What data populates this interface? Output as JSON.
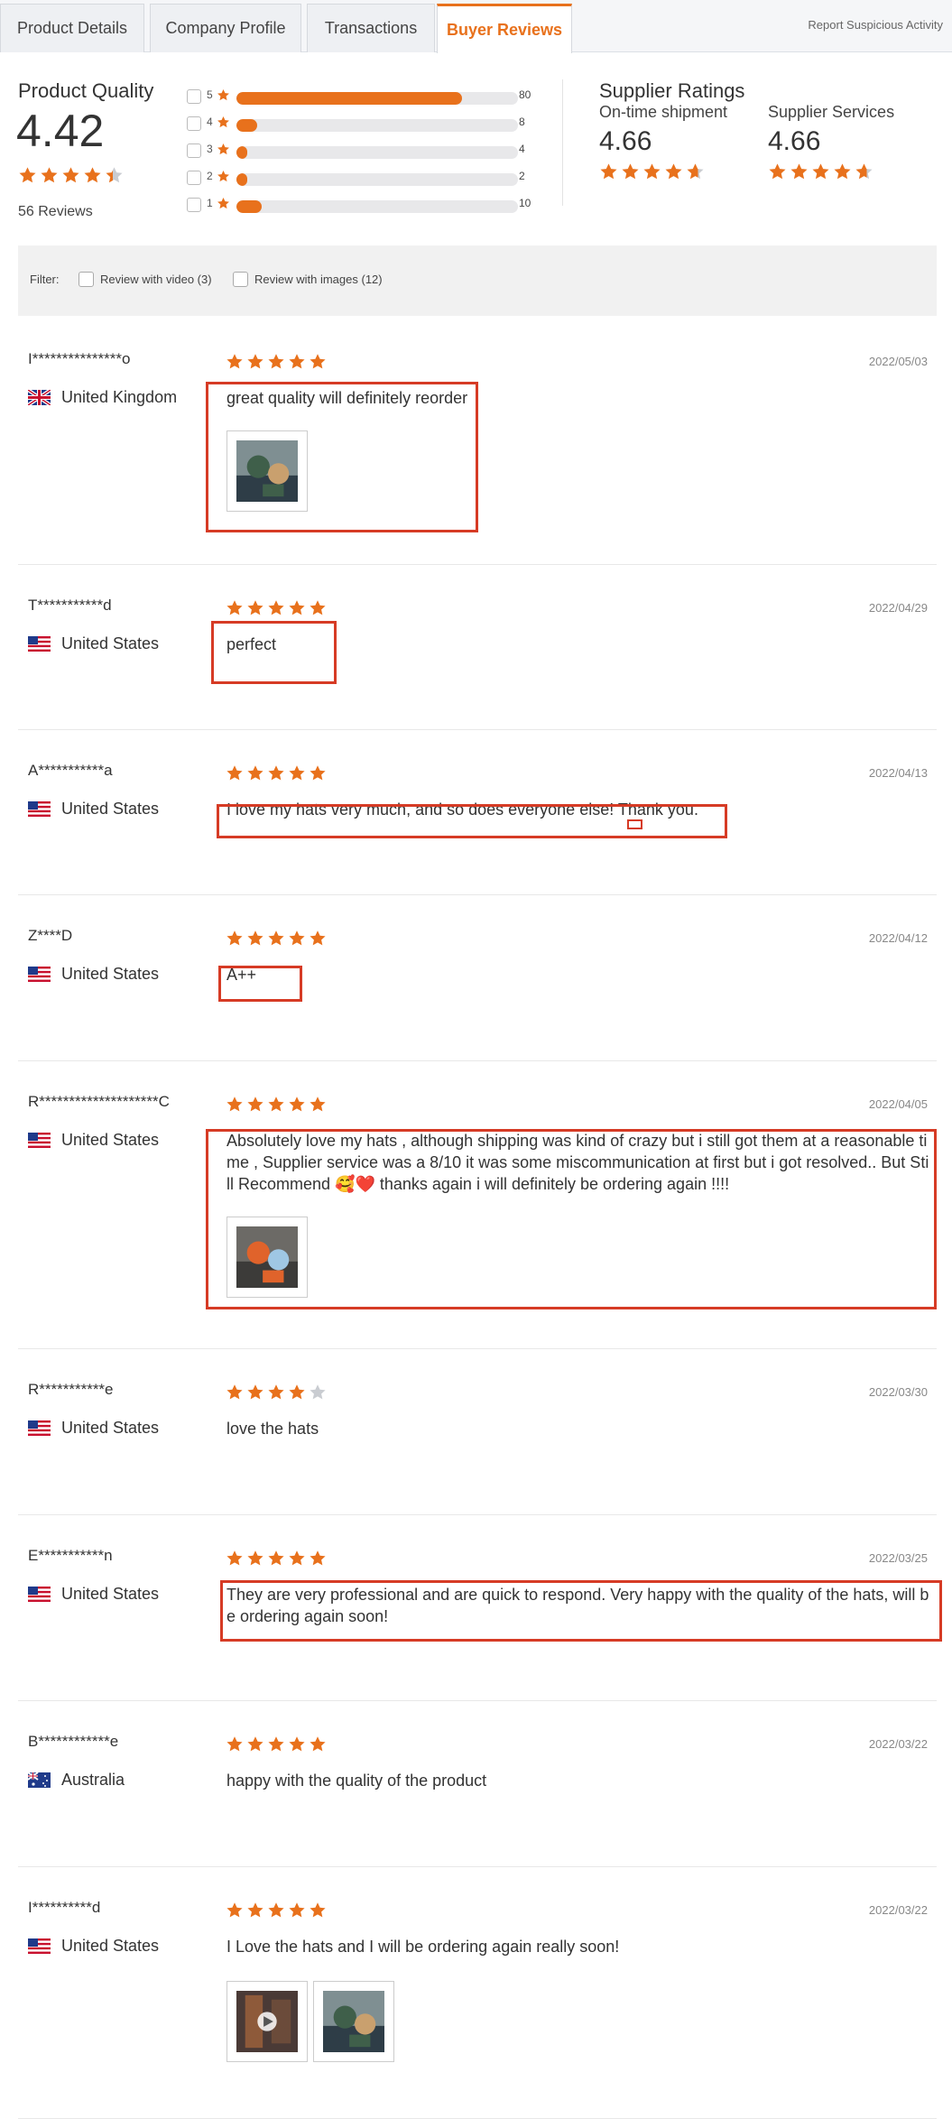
{
  "tabs": [
    {
      "label": "Product Details",
      "active": false
    },
    {
      "label": "Company Profile",
      "active": false
    },
    {
      "label": "Transactions",
      "active": false
    },
    {
      "label": "Buyer Reviews",
      "active": true
    }
  ],
  "report_link": "Report Suspicious Activity",
  "product_quality": {
    "title": "Product Quality",
    "score": "4.42",
    "review_count": "56 Reviews",
    "stars": 4.42
  },
  "rating_distribution": [
    {
      "stars": "5",
      "count": "80",
      "fraction": 0.8
    },
    {
      "stars": "4",
      "count": "8",
      "fraction": 0.075
    },
    {
      "stars": "3",
      "count": "4",
      "fraction": 0.03
    },
    {
      "stars": "2",
      "count": "2",
      "fraction": 0.015
    },
    {
      "stars": "1",
      "count": "10",
      "fraction": 0.09
    }
  ],
  "supplier_ratings": {
    "title": "Supplier Ratings",
    "items": [
      {
        "label": "On-time shipment",
        "value": "4.66",
        "stars": 4.66
      },
      {
        "label": "Supplier Services",
        "value": "4.66",
        "stars": 4.66
      }
    ]
  },
  "filter": {
    "label": "Filter:",
    "options": [
      "Review with video (3)",
      "Review with images (12)"
    ]
  },
  "colors": {
    "accent": "#e8711c",
    "star_empty": "#c9ccd1",
    "highlight_box": "#d63b25"
  },
  "reviews": [
    {
      "name": "I***************o",
      "country": "United Kingdom",
      "flag": "uk-flag",
      "stars": 5,
      "date": "2022/05/03",
      "text": "great quality will definitely reorder",
      "media": [
        "photo"
      ]
    },
    {
      "name": "T***********d",
      "country": "United States",
      "flag": "us-flag",
      "stars": 5,
      "date": "2022/04/29",
      "text": "perfect",
      "media": []
    },
    {
      "name": "A***********a",
      "country": "United States",
      "flag": "us-flag",
      "stars": 5,
      "date": "2022/04/13",
      "text": "I love my hats very much, and so does everyone else! Thank you.",
      "media": []
    },
    {
      "name": "Z****D",
      "country": "United States",
      "flag": "us-flag",
      "stars": 5,
      "date": "2022/04/12",
      "text": "A++",
      "media": []
    },
    {
      "name": "R********************C",
      "country": "United States",
      "flag": "us-flag",
      "stars": 5,
      "date": "2022/04/05",
      "text": "Absolutely love my hats , although shipping was kind of crazy but i still got them at a reasonable time , Supplier service was a 8/10 it was some miscommunication at first but i got resolved.. But Still Recommend 🥰❤️ thanks again i will definitely be ordering again !!!!",
      "media": [
        "photo"
      ]
    },
    {
      "name": "R***********e",
      "country": "United States",
      "flag": "us-flag",
      "stars": 4,
      "date": "2022/03/30",
      "text": "love the hats",
      "media": []
    },
    {
      "name": "E***********n",
      "country": "United States",
      "flag": "us-flag",
      "stars": 5,
      "date": "2022/03/25",
      "text": "They are very professional and are quick to respond. Very happy with the quality of the hats, will be ordering again soon!",
      "media": []
    },
    {
      "name": "B************e",
      "country": "Australia",
      "flag": "au-flag",
      "stars": 5,
      "date": "2022/03/22",
      "text": "happy with the quality of the product",
      "media": []
    },
    {
      "name": "I**********d",
      "country": "United States",
      "flag": "us-flag",
      "stars": 5,
      "date": "2022/03/22",
      "text": "I Love the hats and I will be ordering again really soon!",
      "media": [
        "video",
        "photo"
      ]
    }
  ]
}
